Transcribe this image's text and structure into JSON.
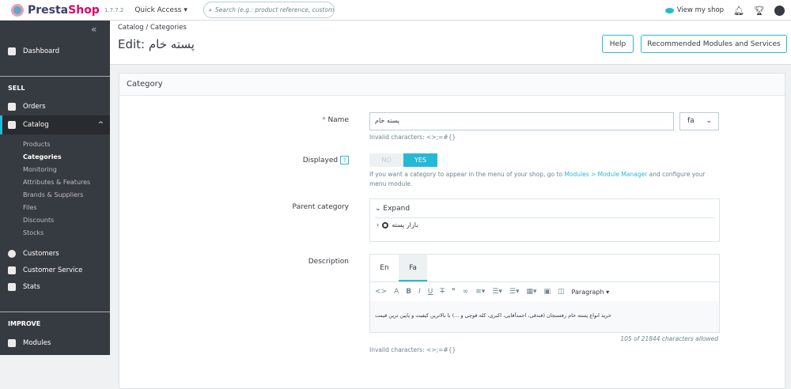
{
  "header": {
    "brand_a": "Presta",
    "brand_b": "Shop",
    "version": "1.7.7.2",
    "quick_access": "Quick Access ▾",
    "search_placeholder": "Search (e.g.: product reference, customer",
    "view_shop": "View my shop"
  },
  "sidebar": {
    "collapse": "«",
    "dashboard": "Dashboard",
    "sell": "SELL",
    "orders": "Orders",
    "catalog": "Catalog",
    "catalog_sub": [
      "Products",
      "Categories",
      "Monitoring",
      "Attributes & Features",
      "Brands & Suppliers",
      "Files",
      "Discounts",
      "Stocks"
    ],
    "customers": "Customers",
    "customer_service": "Customer Service",
    "stats": "Stats",
    "improve": "IMPROVE",
    "modules": "Modules"
  },
  "page": {
    "breadcrumb": [
      "Catalog",
      "Categories"
    ],
    "title": "Edit: پسته خام",
    "help": "Help",
    "recommended": "Recommended Modules and Services"
  },
  "form": {
    "card_title": "Category",
    "name_required": "*",
    "name_label": "Name",
    "name_value": "پسته خام",
    "lang": "fa",
    "invalid": "Invalid characters: <>;=#{}",
    "displayed_label": "Displayed",
    "displayed_help_icon": "?",
    "no": "NO",
    "yes": "YES",
    "displayed_help_a": "If you want a category to appear in the menu of your shop, go to ",
    "displayed_help_link": "Modules > Module Manager",
    "displayed_help_b": " and configure your menu module.",
    "parent_label": "Parent category",
    "expand": "Expand",
    "parent_value": "بازار پسته",
    "description_label": "Description",
    "tabs": [
      "En",
      "Fa"
    ],
    "paragraph": "Paragraph ▾",
    "description": "خرید انواع پسته خام رفسنجان (فندقی، احمدآقایی، اکبری، کله قوچی و ...) با بالاترین کیفیت و پایین ترین قیمت",
    "counter": "105 of 21844 characters allowed",
    "invalid2": "Invalid characters: <>;=#{}"
  }
}
